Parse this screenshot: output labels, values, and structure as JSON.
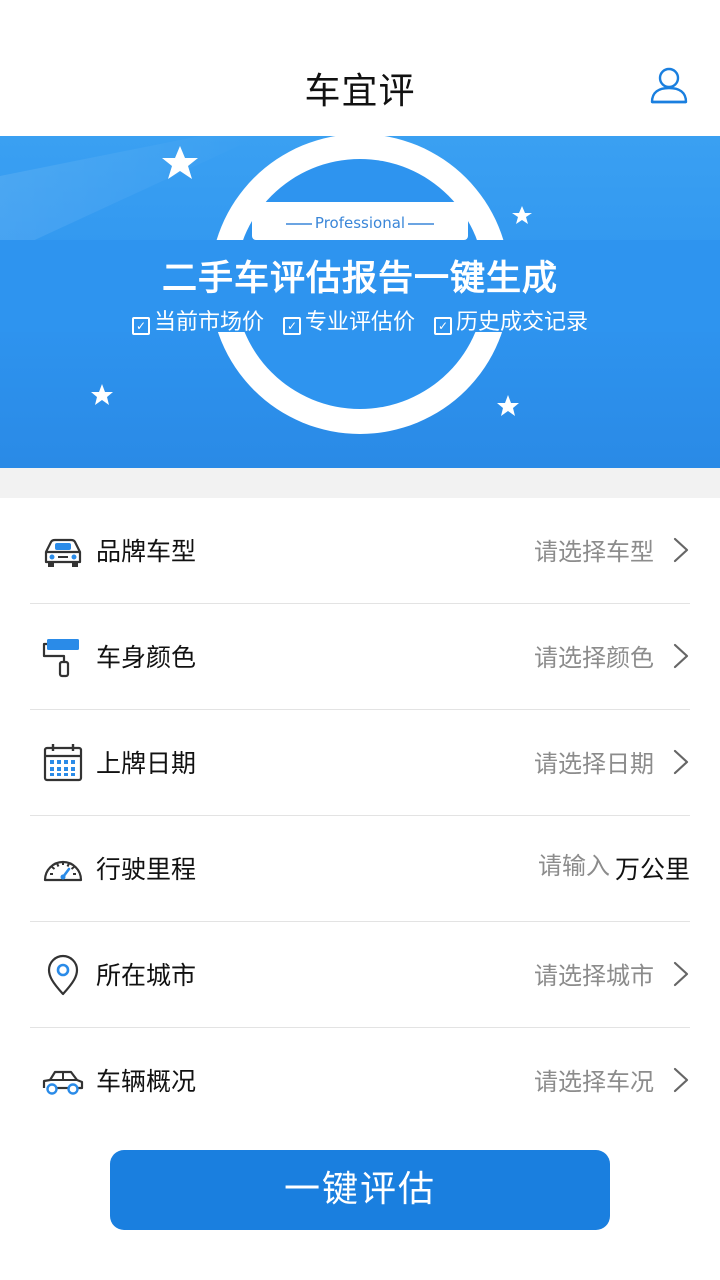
{
  "header": {
    "title": "车宜评",
    "user_icon": "user-icon"
  },
  "banner": {
    "tag": "Professional",
    "headline": "二手车评估报告一键生成",
    "features": [
      "当前市场价",
      "专业评估价",
      "历史成交记录"
    ]
  },
  "form": {
    "rows": [
      {
        "icon": "car-front-icon",
        "label": "品牌车型",
        "placeholder": "请选择车型"
      },
      {
        "icon": "paint-roller-icon",
        "label": "车身颜色",
        "placeholder": "请选择颜色"
      },
      {
        "icon": "calendar-icon",
        "label": "上牌日期",
        "placeholder": "请选择日期"
      },
      {
        "icon": "speedometer-icon",
        "label": "行驶里程",
        "placeholder": "请输入",
        "unit": "万公里"
      },
      {
        "icon": "location-pin-icon",
        "label": "所在城市",
        "placeholder": "请选择城市"
      },
      {
        "icon": "car-side-icon",
        "label": "车辆概况",
        "placeholder": "请选择车况"
      }
    ]
  },
  "submit": {
    "label": "一键评估"
  },
  "colors": {
    "accent": "#1a7fdf",
    "banner_blue": "#2e94ef",
    "text": "#111111",
    "placeholder": "#8c8c8c",
    "divider": "#e3e3e3"
  }
}
